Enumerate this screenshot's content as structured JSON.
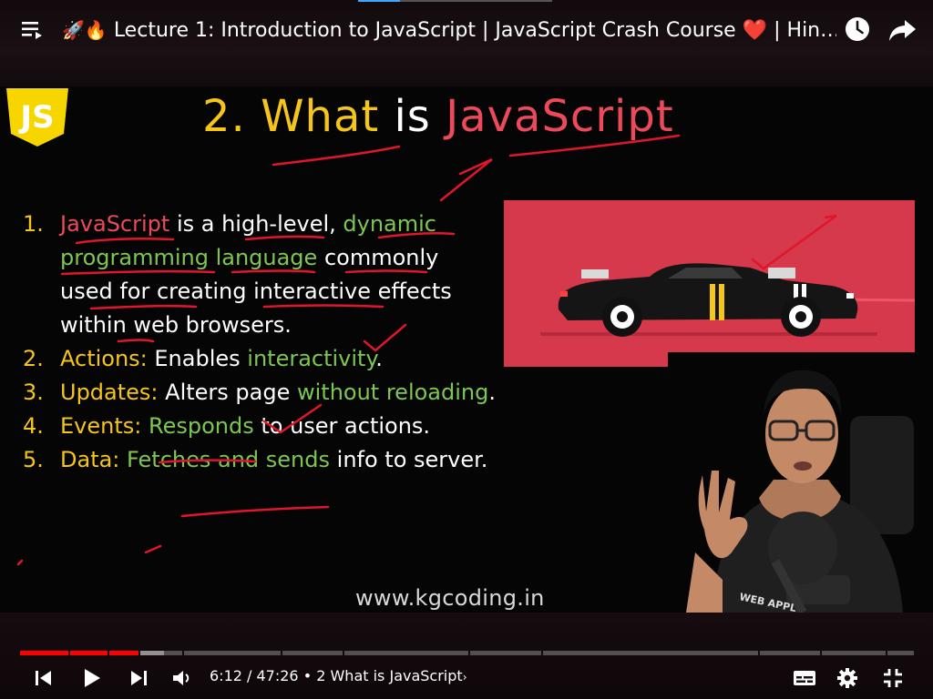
{
  "top_bar": {
    "title_prefix_emoji": "🚀🔥",
    "title": "Lecture 1: Introduction to JavaScript | JavaScript Crash Course",
    "title_heart": "❤️",
    "title_suffix": "| Hin…"
  },
  "slide": {
    "logo_text": "JS",
    "title_num": "2.",
    "title_what": "What",
    "title_is": "is",
    "title_js": "JavaScript",
    "items": [
      {
        "num": "1.",
        "term": "JavaScript",
        "text_a": " is a high-level, ",
        "green_a": "dynamic",
        "green_b": "programming language",
        "text_b": " commonly used for creating interactive effects within web browsers."
      },
      {
        "num": "2.",
        "label": "Actions:",
        "text_a": " Enables ",
        "green": "interactivity",
        "text_b": "."
      },
      {
        "num": "3.",
        "label": "Updates:",
        "text_a": " Alters page ",
        "green": "without reloading",
        "text_b": "."
      },
      {
        "num": "4.",
        "label": "Events:",
        "text_a": " ",
        "green": "Responds",
        "text_b": " to user actions."
      },
      {
        "num": "5.",
        "label": "Data:",
        "text_a": " ",
        "green": "Fetches and sends",
        "text_b": " info to server."
      }
    ],
    "website": "www.kgcoding.in",
    "presenter_shirt_text": "WEB APPL"
  },
  "player": {
    "current_time": "6:12",
    "duration": "47:26",
    "chapter": "2 What is JavaScript",
    "played_fraction": 0.131
  },
  "colors": {
    "slide_yellow": "#f5c518",
    "slide_green": "#7ec652",
    "slide_red": "#ec4a5a",
    "car_panel": "#d6384c",
    "progress_played": "#ff0000"
  }
}
